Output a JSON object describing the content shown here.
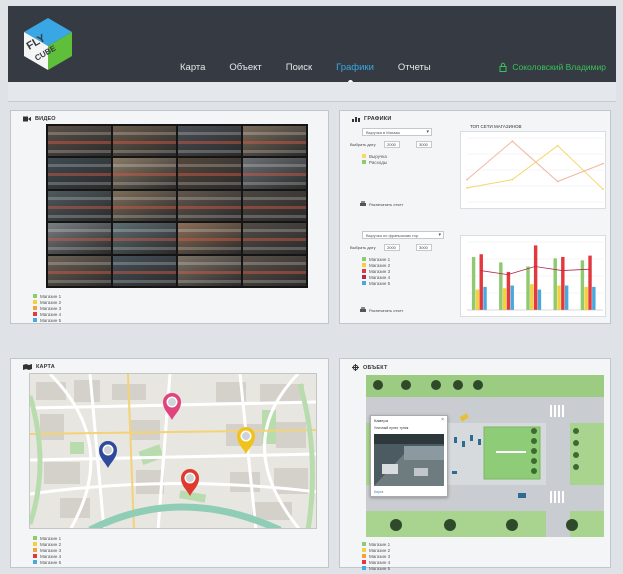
{
  "header": {
    "brand_line1": "FLY",
    "brand_line2": "CUBE",
    "nav": [
      "Карта",
      "Объект",
      "Поиск",
      "Графики",
      "Отчеты"
    ],
    "active_nav": "Графики",
    "user_name": "Соколовский Владимир",
    "colors": {
      "bar": "#363b43",
      "active": "#39a7e3",
      "user": "#38c25a"
    }
  },
  "video": {
    "title": "ВИДЕО",
    "icon": "video-camera-icon",
    "legend": [
      {
        "label": "Магазин 1",
        "color": "#8fc970"
      },
      {
        "label": "Магазин 2",
        "color": "#f4d03f"
      },
      {
        "label": "Магазин 3",
        "color": "#f0a33c"
      },
      {
        "label": "Магазин 4",
        "color": "#e2383e"
      },
      {
        "label": "Магазин 5",
        "color": "#4aa8dc"
      }
    ]
  },
  "charts": {
    "title": "ГРАФИКИ",
    "icon": "bar-chart-icon",
    "top": {
      "select_label": "Выручка в Магазы",
      "date_label": "Выбрать дату",
      "date_from": "2000",
      "date_to": "3000",
      "legend": [
        {
          "label": "Выручка",
          "color": "#f3d86a"
        },
        {
          "label": "Расходы",
          "color": "#8fc970"
        }
      ],
      "report_label": "Распечатать отчет",
      "chart_title": "ТОП СЕТИ МАГАЗИНОВ"
    },
    "bottom": {
      "select_label": "Выручка по франшизам тор.",
      "date_label": "Выбрать дату",
      "date_from": "2000",
      "date_to": "3000",
      "legend": [
        {
          "label": "Магазин 1",
          "color": "#8fc970"
        },
        {
          "label": "Магазин 2",
          "color": "#f4d03f"
        },
        {
          "label": "Магазин 3",
          "color": "#e2383e"
        },
        {
          "label": "Магазин 4",
          "color": "#b02a4a"
        },
        {
          "label": "Магазин 5",
          "color": "#4aa8dc"
        }
      ],
      "report_label": "Распечатать отчет"
    }
  },
  "map": {
    "title": "КАРТА",
    "icon": "map-icon",
    "legend": [
      {
        "label": "Магазин 1",
        "color": "#8fc970"
      },
      {
        "label": "Магазин 2",
        "color": "#f4d03f"
      },
      {
        "label": "Магазин 3",
        "color": "#f0a33c"
      },
      {
        "label": "Магазин 4",
        "color": "#e2383e"
      },
      {
        "label": "Магазин 5",
        "color": "#4aa8dc"
      }
    ],
    "pins": [
      {
        "name": "pin-magenta",
        "color": "#e0447c"
      },
      {
        "name": "pin-blue",
        "color": "#2f4a9c"
      },
      {
        "name": "pin-yellow",
        "color": "#f0c31c"
      },
      {
        "name": "pin-red",
        "color": "#e03a2f"
      }
    ]
  },
  "object": {
    "title": "ОБЪЕКТ",
    "icon": "crosshair-icon",
    "popup_title": "Камера",
    "popup_subtitle": "Уличный пульт, тупик",
    "popup_link": "Карта",
    "legend": [
      {
        "label": "Магазин 1",
        "color": "#8fc970"
      },
      {
        "label": "Магазин 2",
        "color": "#f4d03f"
      },
      {
        "label": "Магазин 3",
        "color": "#f0a33c"
      },
      {
        "label": "Магазин 4",
        "color": "#e2383e"
      },
      {
        "label": "Магазин 5",
        "color": "#4aa8dc"
      }
    ]
  },
  "chart_data": [
    {
      "type": "line",
      "title": "ТОП СЕТИ МАГАЗИНОВ",
      "categories": [
        "",
        "",
        "",
        ""
      ],
      "series": [
        {
          "name": "Выручка",
          "color": "#f3d86a",
          "values": [
            22,
            35,
            88,
            20
          ]
        },
        {
          "name": "Расходы",
          "color": "#f0b7a0",
          "values": [
            35,
            95,
            32,
            60
          ]
        }
      ],
      "ylim": [
        0,
        100
      ]
    },
    {
      "type": "bar",
      "categories": [
        "",
        "",
        "",
        "",
        ""
      ],
      "series": [
        {
          "name": "Магазин 1",
          "color": "#8fc970",
          "values": [
            78,
            70,
            64,
            76,
            73
          ]
        },
        {
          "name": "Магазин 2",
          "color": "#f4d03f",
          "values": [
            30,
            32,
            38,
            36,
            34
          ]
        },
        {
          "name": "Магазин 3",
          "color": "#e2383e",
          "values": [
            82,
            56,
            95,
            78,
            80
          ]
        },
        {
          "name": "Магазин 5",
          "color": "#4aa8dc",
          "values": [
            34,
            36,
            30,
            36,
            34
          ]
        }
      ],
      "line": {
        "color": "#b02a4a",
        "values": [
          58,
          52,
          64,
          58,
          60
        ]
      },
      "ylim": [
        0,
        100
      ]
    }
  ]
}
